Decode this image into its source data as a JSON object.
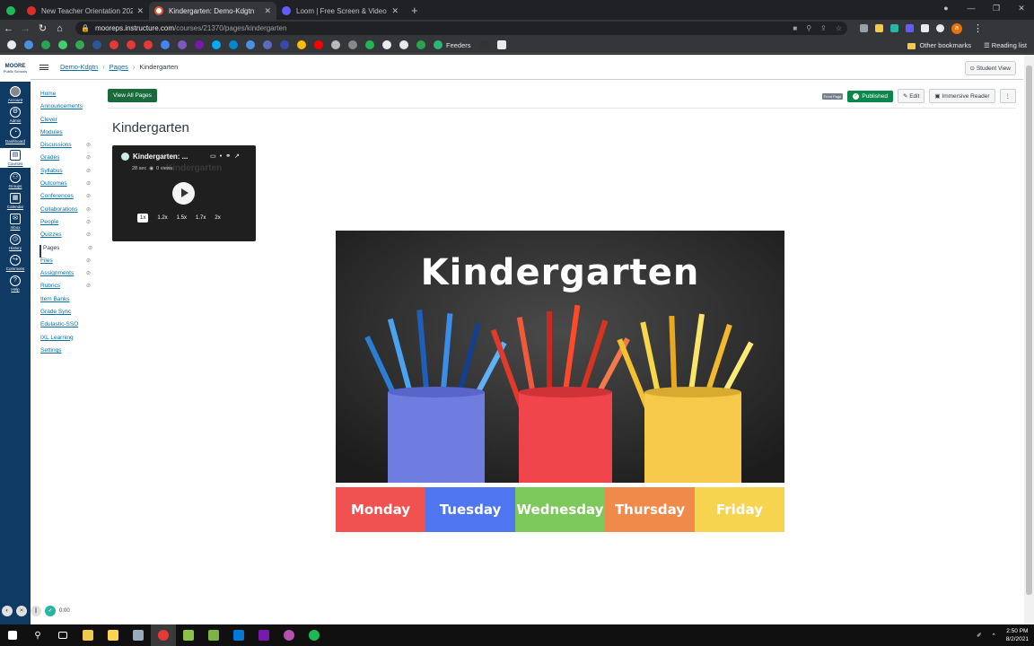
{
  "browser": {
    "tabs": [
      {
        "title": "",
        "color": "#1db954"
      },
      {
        "title": "New Teacher Orientation 2021.p",
        "color": "#d93025"
      },
      {
        "title": "Kindergarten: Demo-Kdgtn",
        "color": "#e4572e",
        "active": true
      },
      {
        "title": "Loom | Free Screen & Video Rec",
        "color": "#625df5"
      }
    ],
    "url_domain": "mooreps.instructure.com",
    "url_path": "/courses/21370/pages/kindergarten",
    "bookmark_feeders": "Feeders",
    "other_bookmarks": "Other bookmarks",
    "reading_list": "Reading list",
    "profile_initial": "a"
  },
  "global_nav": {
    "logo_line1": "MOORE",
    "logo_line2": "Public Schools",
    "items": [
      "Account",
      "Admin",
      "Dashboard",
      "Courses",
      "Groups",
      "Calendar",
      "Inbox",
      "History",
      "Commons",
      "Help"
    ]
  },
  "breadcrumb": {
    "course": "Demo-Kdgtn",
    "section": "Pages",
    "current": "Kindergarten"
  },
  "student_view": "Student View",
  "course_nav": [
    "Home",
    "Announcements",
    "Clever",
    "Modules",
    "Discussions",
    "Grades",
    "Syllabus",
    "Outcomes",
    "Conferences",
    "Collaborations",
    "People",
    "Quizzes",
    "Pages",
    "Files",
    "Assignments",
    "Rubrics",
    "Item Banks",
    "Grade Sync",
    "Edulastic-SSO",
    "IXL Learning",
    "Settings"
  ],
  "toolbar": {
    "view_all": "View All Pages",
    "front_page": "Front Page",
    "published": "Published",
    "edit": "Edit",
    "immersive": "Immersive Reader",
    "more": "⋮"
  },
  "page_title": "Kindergarten",
  "video": {
    "title": "Kindergarten: ...",
    "duration": "28 sec",
    "views": "0 views",
    "speeds": [
      "1x",
      "1.2x",
      "1.5x",
      "1.7x",
      "2x"
    ]
  },
  "banner": {
    "title": "Kindergarten"
  },
  "days": [
    {
      "label": "Monday",
      "color": "#f0524f"
    },
    {
      "label": "Tuesday",
      "color": "#4f76ee"
    },
    {
      "label": "Wednesday",
      "color": "#7cc85a"
    },
    {
      "label": "Thursday",
      "color": "#f08a4b"
    },
    {
      "label": "Friday",
      "color": "#f6d44f"
    }
  ],
  "loom": {
    "time": "0:00"
  },
  "taskbar": {
    "time": "2:50 PM",
    "date": "8/2/2021"
  }
}
